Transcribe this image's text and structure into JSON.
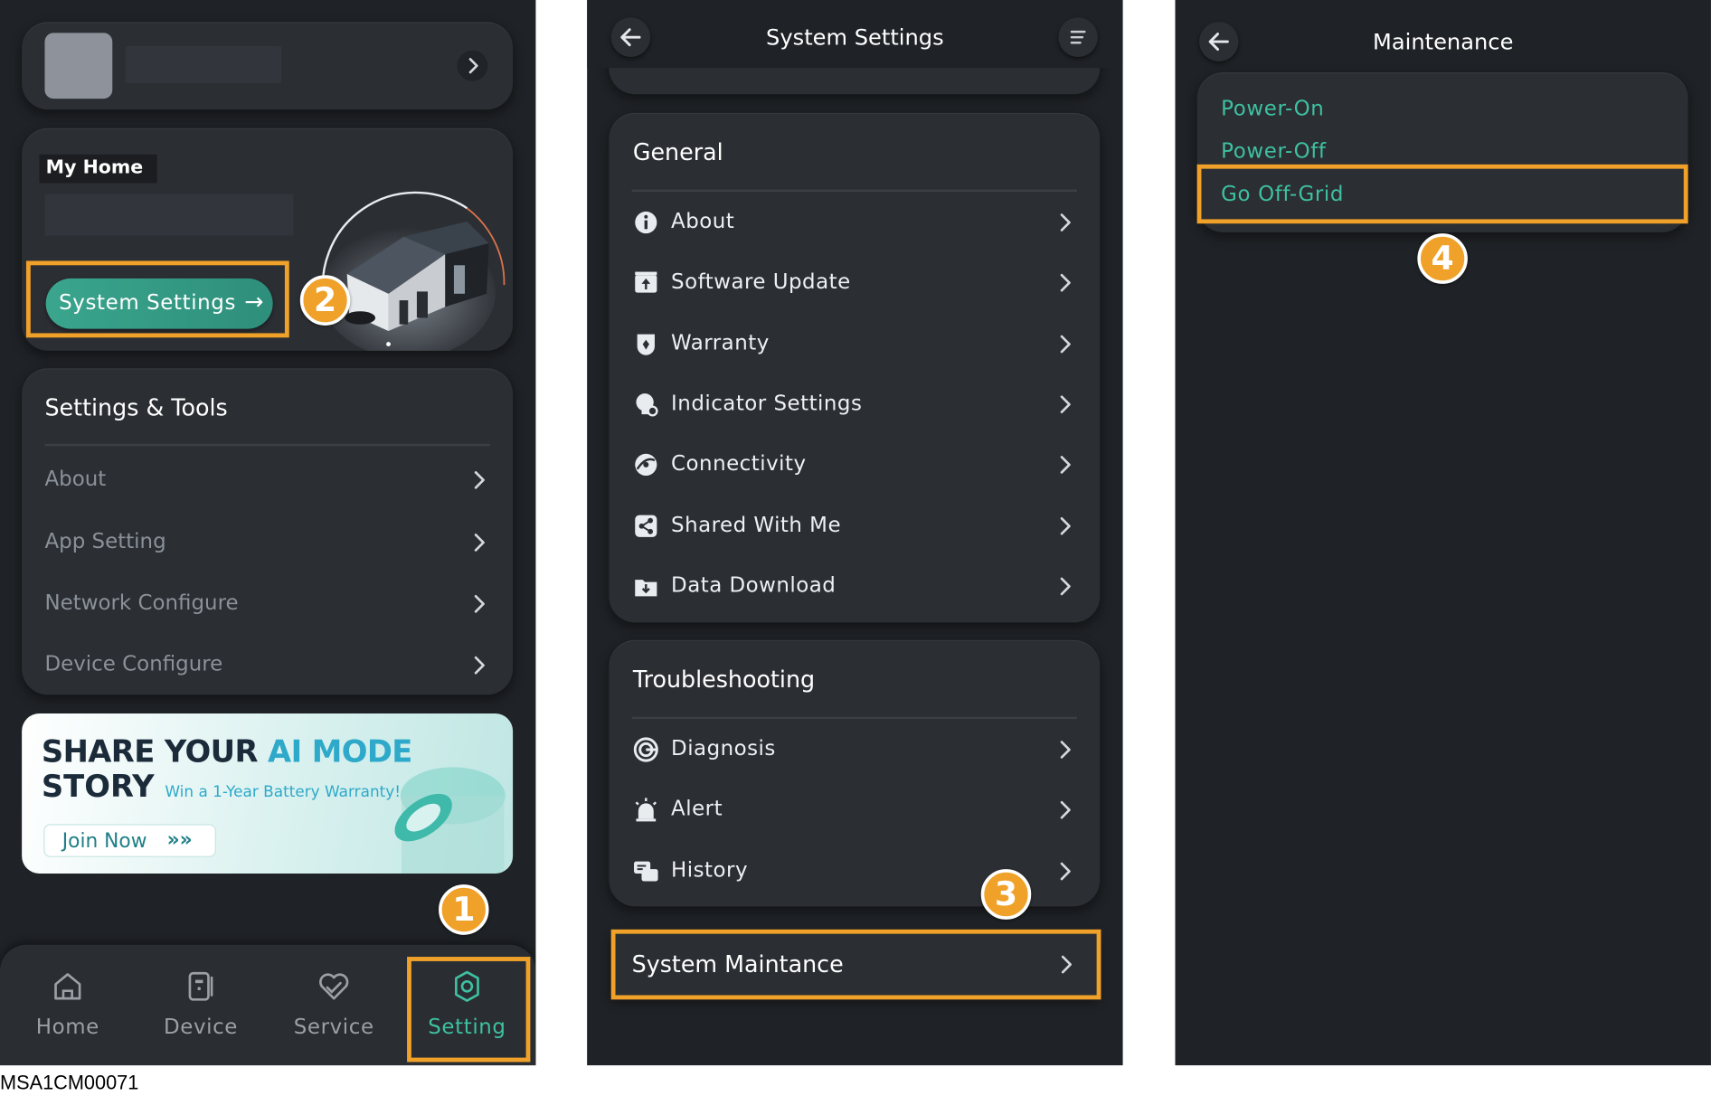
{
  "doc_code": "MSA1CM00071",
  "screen1": {
    "home_card_title": "My Home",
    "system_settings_button": "System Settings",
    "system_settings_arrow": "→",
    "settings_tools_title": "Settings & Tools",
    "settings_items": [
      "About",
      "App Setting",
      "Network Configure",
      "Device Configure"
    ],
    "banner": {
      "line1_dark": "SHARE YOUR",
      "line1_accent": "AI MODE",
      "line2_dark": "STORY",
      "line2_small": "Win a 1-Year Battery Warranty!",
      "join_button": "Join Now",
      "join_arrows": "»»"
    },
    "bottom_nav": [
      {
        "label": "Home",
        "icon": "home-icon",
        "active": false
      },
      {
        "label": "Device",
        "icon": "device-icon",
        "active": false
      },
      {
        "label": "Service",
        "icon": "service-icon",
        "active": false
      },
      {
        "label": "Setting",
        "icon": "setting-icon",
        "active": true
      }
    ]
  },
  "screen2": {
    "title": "System Settings",
    "general_title": "General",
    "general_items": [
      {
        "label": "About",
        "icon": "info-icon"
      },
      {
        "label": "Software Update",
        "icon": "update-icon"
      },
      {
        "label": "Warranty",
        "icon": "warranty-icon"
      },
      {
        "label": "Indicator Settings",
        "icon": "indicator-icon"
      },
      {
        "label": "Connectivity",
        "icon": "connectivity-icon"
      },
      {
        "label": "Shared With Me",
        "icon": "share-icon"
      },
      {
        "label": "Data Download",
        "icon": "download-icon"
      }
    ],
    "troubleshooting_title": "Troubleshooting",
    "troubleshooting_items": [
      {
        "label": "Diagnosis",
        "icon": "diagnosis-icon"
      },
      {
        "label": "Alert",
        "icon": "alert-icon"
      },
      {
        "label": "History",
        "icon": "history-icon"
      }
    ],
    "maintenance_row": "System Maintance"
  },
  "screen3": {
    "title": "Maintenance",
    "items": [
      "Power-On",
      "Power-Off",
      "Go Off-Grid"
    ]
  },
  "steps": [
    "1",
    "2",
    "3",
    "4"
  ],
  "colors": {
    "background": "#1f2226",
    "card": "#2b2e33",
    "accent_teal": "#3ec0a1",
    "highlight_orange": "#f0a12a"
  }
}
